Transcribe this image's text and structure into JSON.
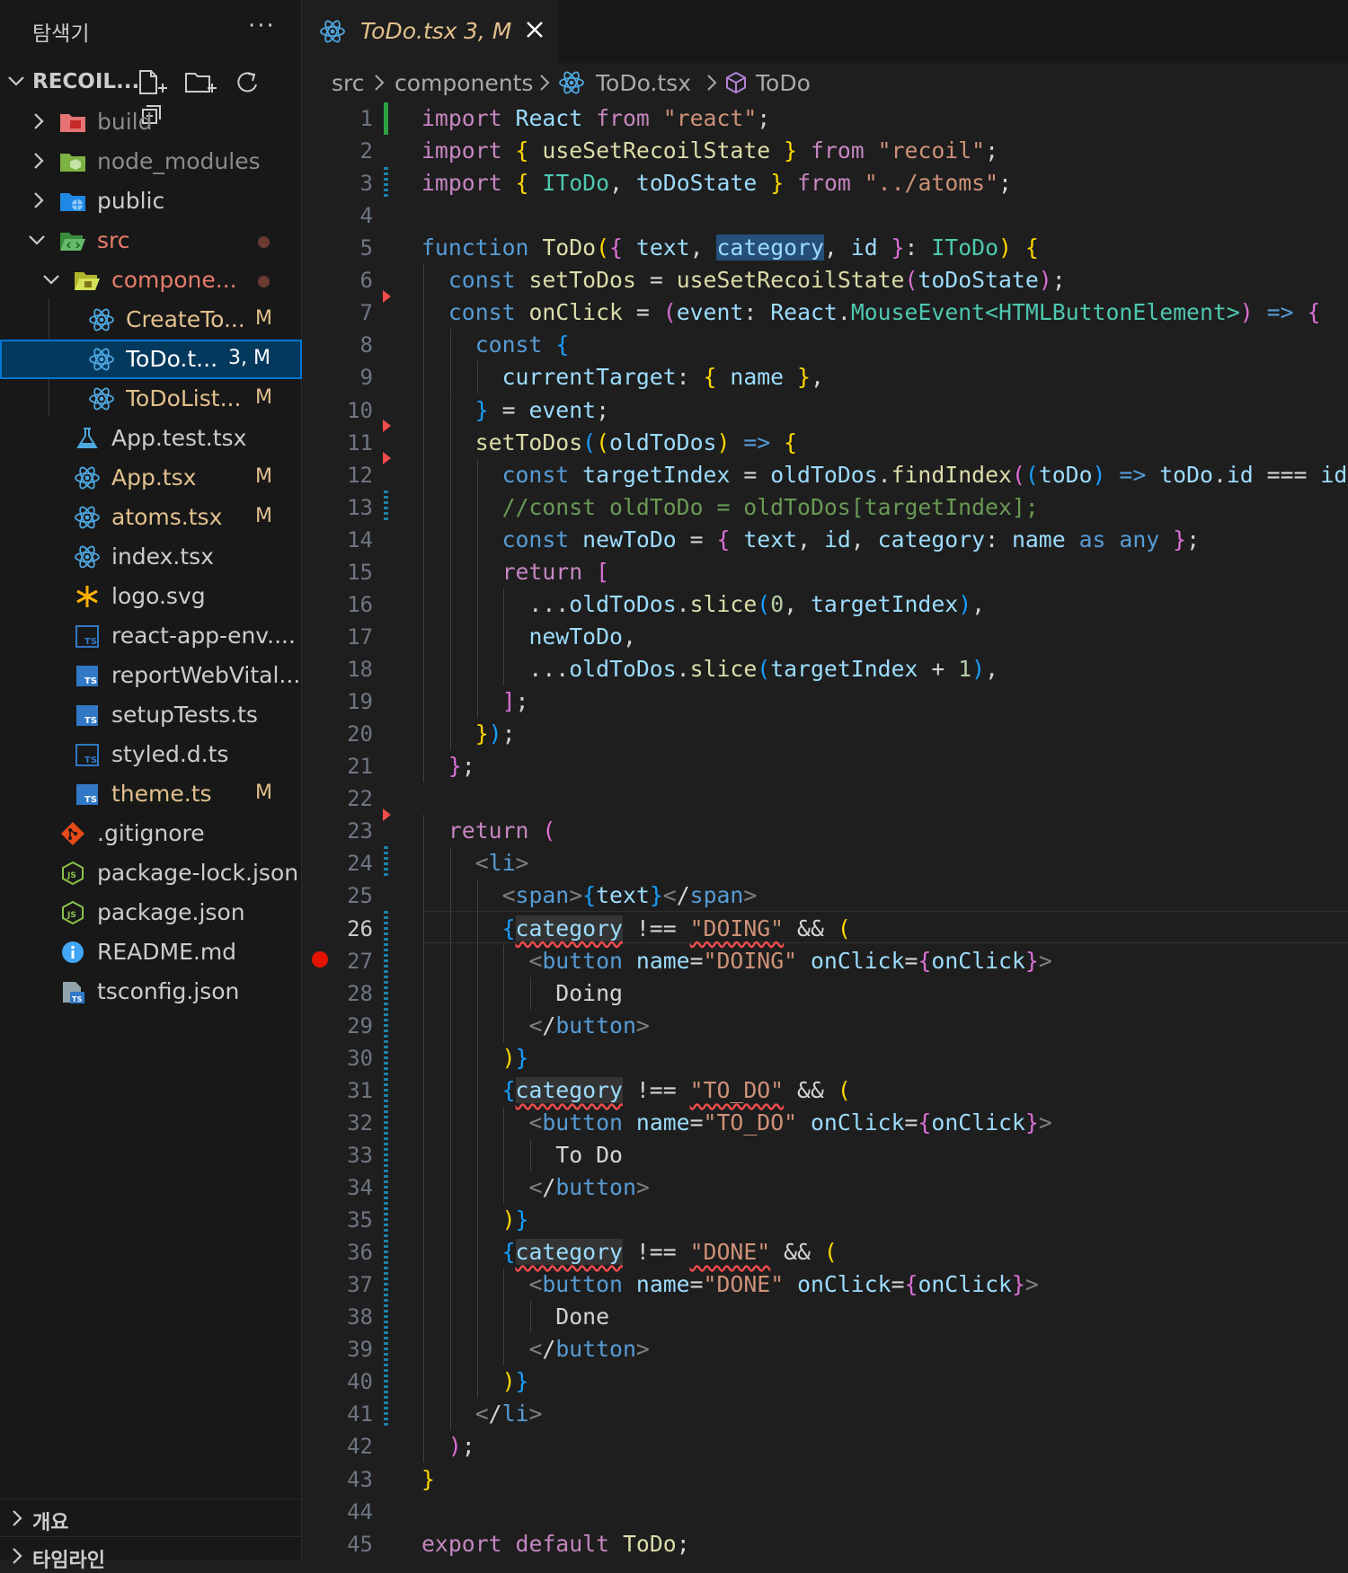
{
  "sidebar": {
    "title": "탐색기",
    "more_icon": "ellipsis-icon",
    "project": "RECOIL...",
    "items": [
      {
        "label": "build",
        "type": "folder",
        "icon_color": "#e57373",
        "badge": "",
        "dot": false
      },
      {
        "label": "node_modules",
        "type": "folder",
        "icon_color": "#8bc34a",
        "badge": "",
        "dot": false
      },
      {
        "label": "public",
        "type": "folder",
        "icon_color": "#42a5f5",
        "badge": "",
        "dot": false
      },
      {
        "label": "src",
        "type": "folder-open",
        "icon_color": "#4caf50",
        "badge": "",
        "dot": true
      },
      {
        "label": "compone...",
        "type": "folder-open",
        "icon_color": "#c0ca33",
        "badge": "",
        "dot": true
      },
      {
        "label": "CreateTo...",
        "type": "react",
        "badge": "M"
      },
      {
        "label": "ToDo.t...",
        "type": "react",
        "badge": "3, M"
      },
      {
        "label": "ToDoList...",
        "type": "react",
        "badge": "M"
      },
      {
        "label": "App.test.tsx",
        "type": "test",
        "badge": ""
      },
      {
        "label": "App.tsx",
        "type": "react",
        "badge": "M"
      },
      {
        "label": "atoms.tsx",
        "type": "react",
        "badge": "M"
      },
      {
        "label": "index.tsx",
        "type": "react",
        "badge": ""
      },
      {
        "label": "logo.svg",
        "type": "svg",
        "badge": ""
      },
      {
        "label": "react-app-env....",
        "type": "ts-outline",
        "badge": ""
      },
      {
        "label": "reportWebVital...",
        "type": "ts",
        "badge": ""
      },
      {
        "label": "setupTests.ts",
        "type": "ts",
        "badge": ""
      },
      {
        "label": "styled.d.ts",
        "type": "ts-outline",
        "badge": ""
      },
      {
        "label": "theme.ts",
        "type": "ts",
        "badge": "M"
      },
      {
        "label": ".gitignore",
        "type": "git",
        "badge": ""
      },
      {
        "label": "package-lock.json",
        "type": "node",
        "badge": ""
      },
      {
        "label": "package.json",
        "type": "node",
        "badge": ""
      },
      {
        "label": "README.md",
        "type": "info",
        "badge": ""
      },
      {
        "label": "tsconfig.json",
        "type": "tsconfig",
        "badge": ""
      }
    ],
    "outline_label": "개요",
    "timeline_label": "타임라인"
  },
  "tab": {
    "name": "ToDo.tsx",
    "badge": "3, M"
  },
  "breadcrumb": [
    "src",
    "components",
    "ToDo.tsx",
    "ToDo"
  ],
  "editor": {
    "active_line": 26,
    "line_count": 45,
    "lines": [
      "import React from \"react\";",
      "import { useSetRecoilState } from \"recoil\";",
      "import { IToDo, toDoState } from \"../atoms\";",
      "",
      "function ToDo({ text, category, id }: IToDo) {",
      "  const setToDos = useSetRecoilState(toDoState);",
      "  const onClick = (event: React.MouseEvent<HTMLButtonElement>) => {",
      "    const {",
      "      currentTarget: { name },",
      "    } = event;",
      "    setToDos((oldToDos) => {",
      "      const targetIndex = oldToDos.findIndex((toDo) => toDo.id === id);",
      "      //const oldToDo = oldToDos[targetIndex];",
      "      const newToDo = { text, id, category: name as any };",
      "      return [",
      "        ...oldToDos.slice(0, targetIndex),",
      "        newToDo,",
      "        ...oldToDos.slice(targetIndex + 1),",
      "      ];",
      "    });",
      "  };",
      "",
      "  return (",
      "    <li>",
      "      <span>{text}</span>",
      "      {category !== \"DOING\" && (",
      "        <button name=\"DOING\" onClick={onClick}>",
      "          Doing",
      "        </button>",
      "      )}",
      "      {category !== \"TO_DO\" && (",
      "        <button name=\"TO_DO\" onClick={onClick}>",
      "          To Do",
      "        </button>",
      "      )}",
      "      {category !== \"DONE\" && (",
      "        <button name=\"DONE\" onClick={onClick}>",
      "          Done",
      "        </button>",
      "      )}",
      "    </li>",
      "  );",
      "}",
      "",
      "export default ToDo;"
    ]
  },
  "colors": {
    "keyword": "#569cd6",
    "control": "#c586c0",
    "function": "#dcdcaa",
    "variable": "#9cdcfe",
    "type": "#4ec9b0",
    "string": "#ce9178",
    "modified_badge": "#e2c08d",
    "selection_border": "#0078d4",
    "breakpoint": "#e51400"
  }
}
